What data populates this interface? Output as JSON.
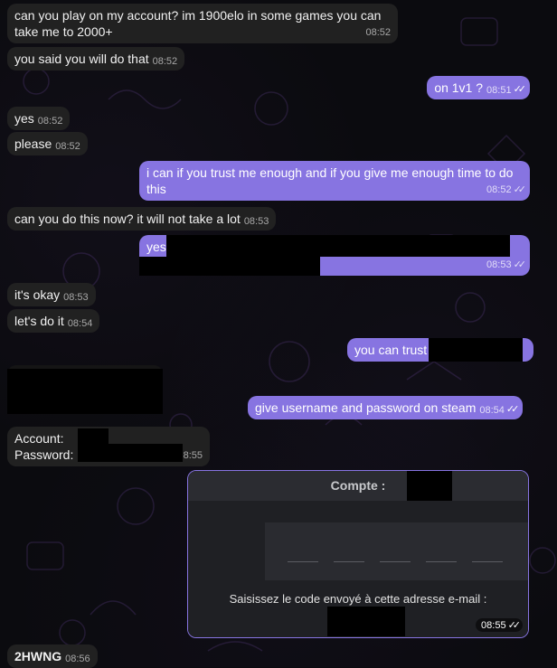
{
  "messages": [
    {
      "id": "m1",
      "dir": "in",
      "text": "can you play on my account? im 1900elo in some games you can take me to 2000+",
      "time": "08:52"
    },
    {
      "id": "m2",
      "dir": "in",
      "text": "you said you will do that",
      "time": "08:52"
    },
    {
      "id": "m3",
      "dir": "out",
      "text": "on 1v1 ?",
      "time": "08:51",
      "status": "read"
    },
    {
      "id": "m4",
      "dir": "in",
      "text": "yes",
      "time": "08:52"
    },
    {
      "id": "m5",
      "dir": "in",
      "text": "please",
      "time": "08:52"
    },
    {
      "id": "m6",
      "dir": "out",
      "text": "i can if you trust me enough and if you give me enough time to do this",
      "time": "08:52",
      "status": "read"
    },
    {
      "id": "m7",
      "dir": "in",
      "text": "can you do this now? it will not take a lot",
      "time": "08:53"
    },
    {
      "id": "m8",
      "dir": "out",
      "text": "yes",
      "time": "08:53",
      "status": "read"
    },
    {
      "id": "m9",
      "dir": "in",
      "text": "it's okay",
      "time": "08:53"
    },
    {
      "id": "m10",
      "dir": "in",
      "text": "let's do it",
      "time": "08:54"
    },
    {
      "id": "m11",
      "dir": "out",
      "text": "you can trust",
      "time": "",
      "status": ""
    },
    {
      "id": "m12",
      "dir": "out",
      "text": "give username and password on steam",
      "time": "08:54",
      "status": "read"
    },
    {
      "id": "m13",
      "dir": "in",
      "text_line1": "Account:",
      "text_line2": "Password:",
      "time": "8:55"
    },
    {
      "id": "m14",
      "dir": "out",
      "time": "08:55",
      "status": "read"
    },
    {
      "id": "m15",
      "dir": "in",
      "text": "2HWNG",
      "time": "08:56"
    }
  ],
  "steam_card": {
    "title": "Compte :",
    "instruction": "Saisissez le code envoyé à cette adresse e-mail :",
    "time": "08:55"
  },
  "ticks_glyph": "✓✓",
  "colors": {
    "outgoing": "#8774e1",
    "incoming": "#212121",
    "background": "#0b0b0f"
  }
}
